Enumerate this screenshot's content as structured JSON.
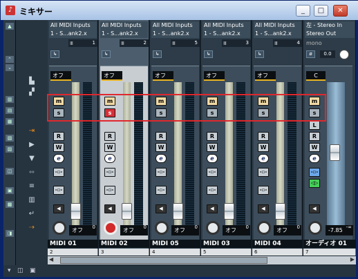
{
  "window": {
    "title": "ミキサー",
    "icon": "mixer-icon"
  },
  "titlebar_buttons": [
    "_",
    "□",
    "✕"
  ],
  "channels": [
    {
      "input": "All MIDI Inputs",
      "output": "1 - S...ank2.x",
      "program": "1",
      "level": "オフ",
      "fader_value": "オフ",
      "fader_top": "0",
      "name": "MIDI 01",
      "number": "2",
      "selected": false
    },
    {
      "input": "All MIDI Inputs",
      "output": "1 - S...ank2.x",
      "program": "2",
      "level": "オフ",
      "fader_value": "オフ",
      "fader_top": "0",
      "name": "MIDI 02",
      "number": "3",
      "selected": true
    },
    {
      "input": "All MIDI Inputs",
      "output": "1 - S...ank2.x",
      "program": "5",
      "level": "オフ",
      "fader_value": "オフ",
      "fader_top": "0",
      "name": "MIDI 05",
      "number": "4",
      "selected": false
    },
    {
      "input": "All MIDI Inputs",
      "output": "1 - S...ank2.x",
      "program": "3",
      "level": "オフ",
      "fader_value": "オフ",
      "fader_top": "0",
      "name": "MIDI 03",
      "number": "5",
      "selected": false
    },
    {
      "input": "All MIDI Inputs",
      "output": "1 - S...ank2.x",
      "program": "4",
      "level": "オフ",
      "fader_value": "オフ",
      "fader_top": "0",
      "name": "MIDI 04",
      "number": "6",
      "selected": false
    }
  ],
  "audio": {
    "input": "左 - Stereo In",
    "output": "Stereo Out",
    "mode": "mono",
    "pan_value": "0.0",
    "level": "C",
    "fader_value": "-7.85",
    "fader_top": "-∞",
    "name": "オーディオ 01",
    "number": "7"
  },
  "buttons": {
    "mute": "m",
    "solo": "s",
    "read": "R",
    "write": "W",
    "edit": "e",
    "level_off": "オフ"
  }
}
